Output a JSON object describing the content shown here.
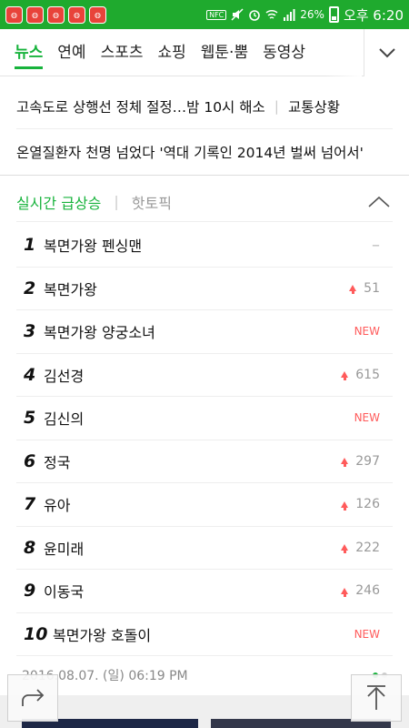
{
  "status_bar": {
    "notification_icons": [
      "app-notification",
      "app-notification",
      "app-notification",
      "app-notification",
      "app-notification"
    ],
    "nfc_label": "NFC",
    "battery": "26%",
    "time": "오후 6:20",
    "bar_color": "#1faa2e"
  },
  "tabs": {
    "items": [
      {
        "label": "뉴스",
        "active": true
      },
      {
        "label": "연예",
        "active": false
      },
      {
        "label": "스포츠",
        "active": false
      },
      {
        "label": "쇼핑",
        "active": false
      },
      {
        "label": "웹툰·뿜",
        "active": false
      },
      {
        "label": "동영상",
        "active": false
      }
    ],
    "accent": "#17b33c",
    "more_icon": "chevron-down-icon"
  },
  "headlines": [
    {
      "title": "고속도로 상행선 정체 절정…밤 10시 해소",
      "tag": "교통상황"
    },
    {
      "title": "온열질환자 천명 넘었다 '역대 기록인 2014년 벌써 넘어서'"
    }
  ],
  "ranking": {
    "tab_active": "실시간 급상승",
    "tab_inactive": "핫토픽",
    "items": [
      {
        "rank": "1",
        "term": "복면가왕 펜싱맨",
        "change": "–",
        "type": "same"
      },
      {
        "rank": "2",
        "term": "복면가왕",
        "change": "51",
        "type": "up"
      },
      {
        "rank": "3",
        "term": "복면가왕 양궁소녀",
        "change": "NEW",
        "type": "new"
      },
      {
        "rank": "4",
        "term": "김선경",
        "change": "615",
        "type": "up"
      },
      {
        "rank": "5",
        "term": "김신의",
        "change": "NEW",
        "type": "new"
      },
      {
        "rank": "6",
        "term": "정국",
        "change": "297",
        "type": "up"
      },
      {
        "rank": "7",
        "term": "유아",
        "change": "126",
        "type": "up"
      },
      {
        "rank": "8",
        "term": "윤미래",
        "change": "222",
        "type": "up"
      },
      {
        "rank": "9",
        "term": "이동국",
        "change": "246",
        "type": "up"
      },
      {
        "rank": "10",
        "term": "복면가왕 호돌이",
        "change": "NEW",
        "type": "new"
      }
    ],
    "timestamp": "2016.08.07. (일) 06:19 PM",
    "page_dots": 2,
    "active_page": 1
  },
  "floating_buttons": {
    "share_icon": "share-arrow-icon",
    "top_icon": "scroll-to-top-icon"
  }
}
